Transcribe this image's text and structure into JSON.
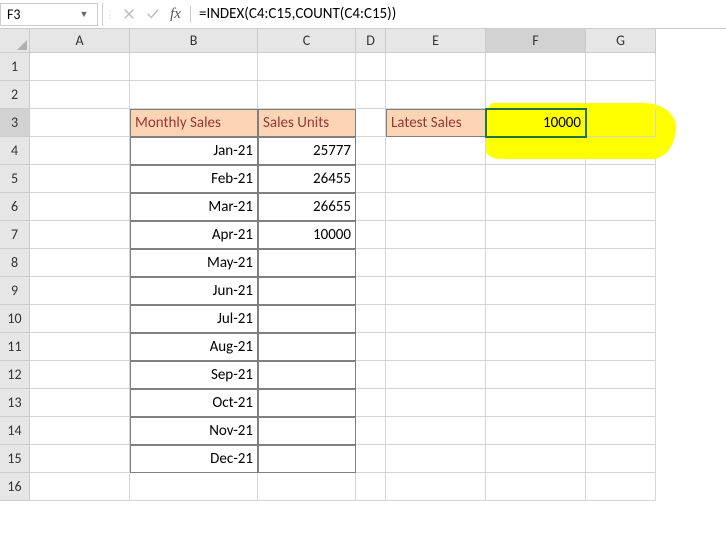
{
  "selected_cell_ref": "F3",
  "formula": "=INDEX(C4:C15,COUNT(C4:C15))",
  "columns": [
    "A",
    "B",
    "C",
    "D",
    "E",
    "F",
    "G"
  ],
  "rows": [
    "1",
    "2",
    "3",
    "4",
    "5",
    "6",
    "7",
    "8",
    "9",
    "10",
    "11",
    "12",
    "13",
    "14",
    "15",
    "16"
  ],
  "active_col": "F",
  "active_row": "3",
  "headers": {
    "monthly_sales": "Monthly Sales",
    "sales_units": "Sales Units",
    "latest_sales": "Latest Sales"
  },
  "result_value": "10000",
  "table": [
    {
      "month": "Jan-21",
      "units": "25777"
    },
    {
      "month": "Feb-21",
      "units": "26455"
    },
    {
      "month": "Mar-21",
      "units": "26655"
    },
    {
      "month": "Apr-21",
      "units": "10000"
    },
    {
      "month": "May-21",
      "units": ""
    },
    {
      "month": "Jun-21",
      "units": ""
    },
    {
      "month": "Jul-21",
      "units": ""
    },
    {
      "month": "Aug-21",
      "units": ""
    },
    {
      "month": "Sep-21",
      "units": ""
    },
    {
      "month": "Oct-21",
      "units": ""
    },
    {
      "month": "Nov-21",
      "units": ""
    },
    {
      "month": "Dec-21",
      "units": ""
    }
  ],
  "chart_data": {
    "type": "table",
    "title": "Monthly Sales",
    "columns": [
      "Monthly Sales",
      "Sales Units"
    ],
    "rows": [
      [
        "Jan-21",
        25777
      ],
      [
        "Feb-21",
        26455
      ],
      [
        "Mar-21",
        26655
      ],
      [
        "Apr-21",
        10000
      ],
      [
        "May-21",
        null
      ],
      [
        "Jun-21",
        null
      ],
      [
        "Jul-21",
        null
      ],
      [
        "Aug-21",
        null
      ],
      [
        "Sep-21",
        null
      ],
      [
        "Oct-21",
        null
      ],
      [
        "Nov-21",
        null
      ],
      [
        "Dec-21",
        null
      ]
    ],
    "derived": {
      "Latest Sales": 10000
    }
  }
}
